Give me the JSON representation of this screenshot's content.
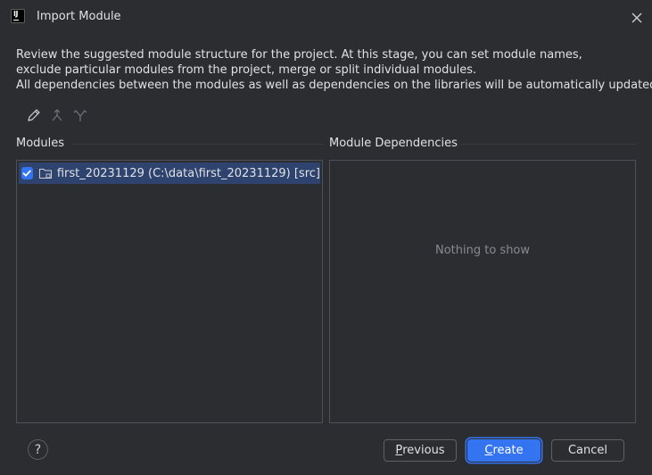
{
  "window": {
    "title": "Import Module",
    "app_icon_text": "IJ",
    "close_icon": "close-icon"
  },
  "description": {
    "line1": "Review the suggested module structure for the project. At this stage, you can set module names,",
    "line2": "exclude particular modules from the project, merge or split individual modules.",
    "line3": "All dependencies between the modules as well as dependencies on the libraries will be automatically updated."
  },
  "toolbar": {
    "icons": [
      "edit-icon",
      "merge-icon",
      "split-icon"
    ]
  },
  "modules": {
    "label": "Modules",
    "items": [
      {
        "checked": true,
        "icon": "folder-icon",
        "text": "first_20231129 (C:\\data\\first_20231129) [src]"
      }
    ]
  },
  "dependencies": {
    "label": "Module Dependencies",
    "empty_text": "Nothing to show"
  },
  "footer": {
    "help_label": "?",
    "previous": {
      "mnemonic": "P",
      "rest": "revious"
    },
    "create": {
      "mnemonic": "C",
      "rest": "reate"
    },
    "cancel_label": "Cancel"
  },
  "colors": {
    "background": "#2b2d30",
    "accent": "#3574f0",
    "selection": "#2e436e",
    "text": "#dfe1e5",
    "muted_text": "#868a91"
  }
}
